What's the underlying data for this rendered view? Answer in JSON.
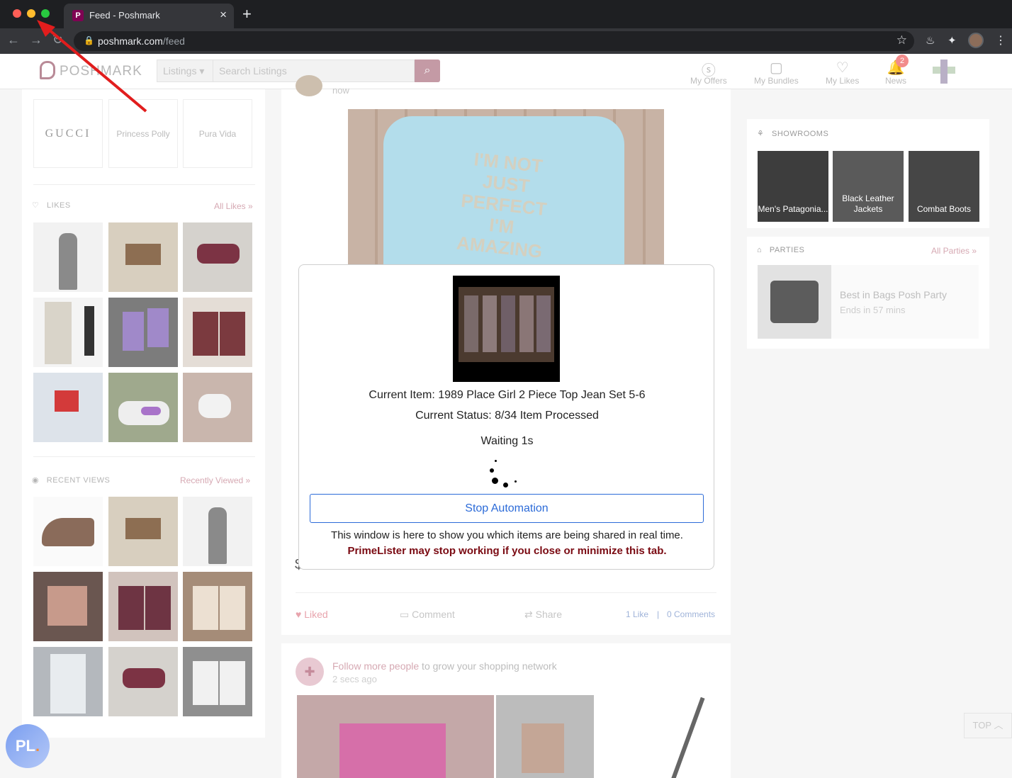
{
  "browser": {
    "tab_title": "Feed - Poshmark",
    "url_host": "poshmark.com",
    "url_path": "/feed"
  },
  "header": {
    "logo_text": "POSHMARK",
    "category_select": "Listings",
    "search_placeholder": "Search Listings",
    "nav": [
      {
        "label": "My Offers"
      },
      {
        "label": "My Bundles"
      },
      {
        "label": "My Likes"
      },
      {
        "label": "News"
      }
    ],
    "news_badge": "2"
  },
  "left": {
    "brands": [
      "GUCCI",
      "Princess Polly",
      "Pura Vida"
    ],
    "likes_title": "LIKES",
    "likes_link": "All Likes »",
    "recent_title": "RECENT VIEWS",
    "recent_link": "Recently Viewed »"
  },
  "feed": {
    "timestamp_top": "now",
    "actions": {
      "liked": "Liked",
      "comment": "Comment",
      "share": "Share",
      "likes_count": "1 Like",
      "separator": "|",
      "comments_count": "0 Comments"
    },
    "follow_link": "Follow more people",
    "follow_text": " to grow your shopping network",
    "follow_time": "2 secs ago"
  },
  "right": {
    "showrooms_title": "SHOWROOMS",
    "showrooms": [
      "Men's Patagonia...",
      "Black Leather Jackets",
      "Combat Boots"
    ],
    "parties_title": "PARTIES",
    "parties_link": "All Parties »",
    "party_name": "Best in Bags Posh Party",
    "party_ends": "Ends in 57 mins"
  },
  "modal": {
    "current_item": "Current Item: 1989 Place Girl 2 Piece Top Jean Set 5-6",
    "current_status": "Current Status: 8/34 Item Processed",
    "waiting": "Waiting 1s",
    "stop_label": "Stop Automation",
    "note": "This window is here to show you which items are being shared in real time.",
    "warning": "PrimeLister may stop working if you close or minimize this tab."
  },
  "top_button": "TOP",
  "pl_badge": "PL",
  "colors": {
    "accent": "#2c6bd8",
    "warning": "#7a0a12",
    "brand": "#7f0353"
  }
}
